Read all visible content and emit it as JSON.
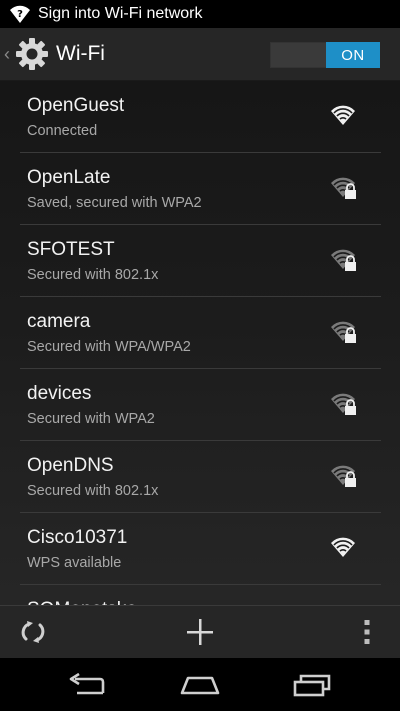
{
  "status_bar": {
    "notification_icon": "wifi-question-icon",
    "text": "Sign into Wi-Fi network"
  },
  "action_bar": {
    "up_icon": "up-caret-icon",
    "app_icon": "settings-gear-icon",
    "title": "Wi-Fi",
    "toggle_label": "ON",
    "toggle_state": "on",
    "accent_color": "#1e8fc7"
  },
  "networks": [
    {
      "ssid": "OpenGuest",
      "summary": "Connected",
      "secured": false,
      "signal_icon": "wifi-signal-icon"
    },
    {
      "ssid": "OpenLate",
      "summary": "Saved, secured with WPA2",
      "secured": true,
      "signal_icon": "wifi-signal-lock-icon"
    },
    {
      "ssid": "SFOTEST",
      "summary": "Secured with 802.1x",
      "secured": true,
      "signal_icon": "wifi-signal-lock-icon"
    },
    {
      "ssid": "camera",
      "summary": "Secured with WPA/WPA2",
      "secured": true,
      "signal_icon": "wifi-signal-lock-icon"
    },
    {
      "ssid": "devices",
      "summary": "Secured with WPA2",
      "secured": true,
      "signal_icon": "wifi-signal-lock-icon"
    },
    {
      "ssid": "OpenDNS",
      "summary": "Secured with 802.1x",
      "secured": true,
      "signal_icon": "wifi-signal-lock-icon"
    },
    {
      "ssid": "Cisco10371",
      "summary": "WPS available",
      "secured": false,
      "signal_icon": "wifi-signal-icon"
    },
    {
      "ssid": "SOMenetsko",
      "summary": "",
      "secured": true,
      "signal_icon": "wifi-signal-lock-icon"
    }
  ],
  "bottom_toolbar": {
    "wps_icon": "wps-icon",
    "add_icon": "add-network-icon",
    "overflow_icon": "overflow-menu-icon"
  },
  "nav_bar": {
    "back_icon": "back-icon",
    "home_icon": "home-icon",
    "recents_icon": "recent-apps-icon"
  }
}
